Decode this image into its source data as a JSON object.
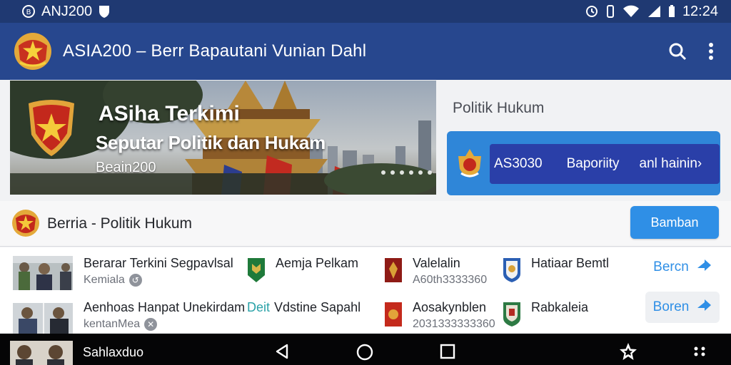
{
  "status_bar": {
    "app_name": "ANJ200",
    "time": "12:24"
  },
  "app_bar": {
    "title": "ASIA200 – Berr Bapautani Vunian Dahl",
    "icons": [
      "logo-emblem",
      "search-icon",
      "more-vert-icon"
    ]
  },
  "hero": {
    "title": "ASiha Terkimi",
    "subtitle": "Seputar Politik dan Hukam",
    "tag": "Beain200"
  },
  "side": {
    "heading": "Politik Hukum",
    "promo": {
      "label_1": "AS3030",
      "label_2": "Baporiity",
      "label_3": "anl hainin›"
    }
  },
  "section": {
    "title": "Berria - Politik Hukum",
    "button": "Bamban"
  },
  "rows": [
    {
      "title": "Berarar Terkini Segpavlsal",
      "meta": "Kemiala",
      "col2": {
        "prefix": "",
        "title": "Aemja Pelkam"
      },
      "col3": {
        "title": "Valelalin",
        "sub": "A60th3333360"
      },
      "col4": {
        "title": "Hatiaar Bemtl"
      },
      "link": "Bercn",
      "badge_color": "#1f7a3a"
    },
    {
      "title": "Aenhoas Hanpat Unekirdam",
      "meta": "kentanMea",
      "col2": {
        "prefix": "Deit",
        "title": "Vdstine Sapahl"
      },
      "col3": {
        "title": "Aosakynblen",
        "sub": "2031333333360"
      },
      "col4": {
        "title": "Rabkaleia"
      },
      "link": "Boren",
      "badge_color": "#c42a1c"
    }
  ],
  "nav_bar": {
    "label": "Sahlaxduo"
  },
  "colors": {
    "status_bar": "#1f3972",
    "app_bar": "#27478e",
    "accent": "#2f8fe6",
    "promo_inner": "#2a3fa8"
  }
}
